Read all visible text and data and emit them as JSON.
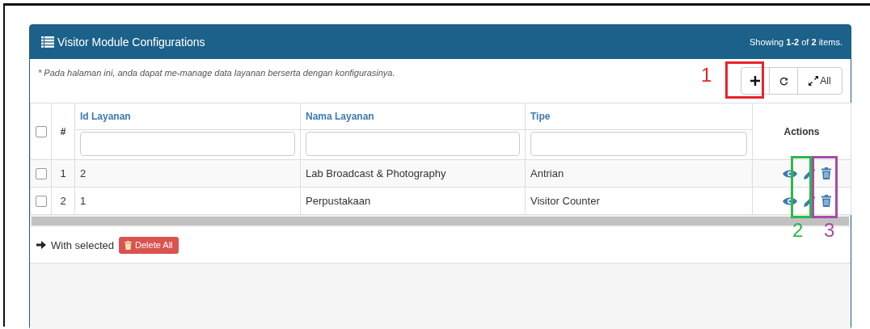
{
  "panel": {
    "title": "Visitor Module Configurations",
    "summary": "Showing **1-2** of **2** items.",
    "hint": "* Pada halaman ini, anda dapat me-manage data layanan berserta dengan konfigurasinya."
  },
  "toolbar": [
    {
      "kind": "add"
    },
    {
      "kind": "refresh"
    },
    {
      "kind": "expand",
      "label": "All"
    }
  ],
  "table": {
    "select_all_checked": false,
    "columns": [
      {
        "label": "#",
        "kind": "index"
      },
      {
        "label": "Id Layanan",
        "kind": "filter"
      },
      {
        "label": "Nama Layanan",
        "kind": "filter"
      },
      {
        "label": "Tipe",
        "kind": "filter"
      },
      {
        "label": "Actions",
        "kind": "actions"
      }
    ],
    "rows": [
      {
        "checked": false,
        "cells": [
          "1",
          "2",
          "Lab Broadcast & Photography",
          "Antrian"
        ]
      },
      {
        "checked": false,
        "cells": [
          "2",
          "1",
          "Perpustakaan",
          "Visitor Counter"
        ]
      }
    ]
  },
  "footer": {
    "label": "With selected",
    "button": "Delete All"
  },
  "annotations": [
    {
      "label": "1",
      "color": "#e8232a"
    },
    {
      "label": "2",
      "color": "#2db84a"
    },
    {
      "label": "3",
      "color": "#a64ca6"
    }
  ]
}
